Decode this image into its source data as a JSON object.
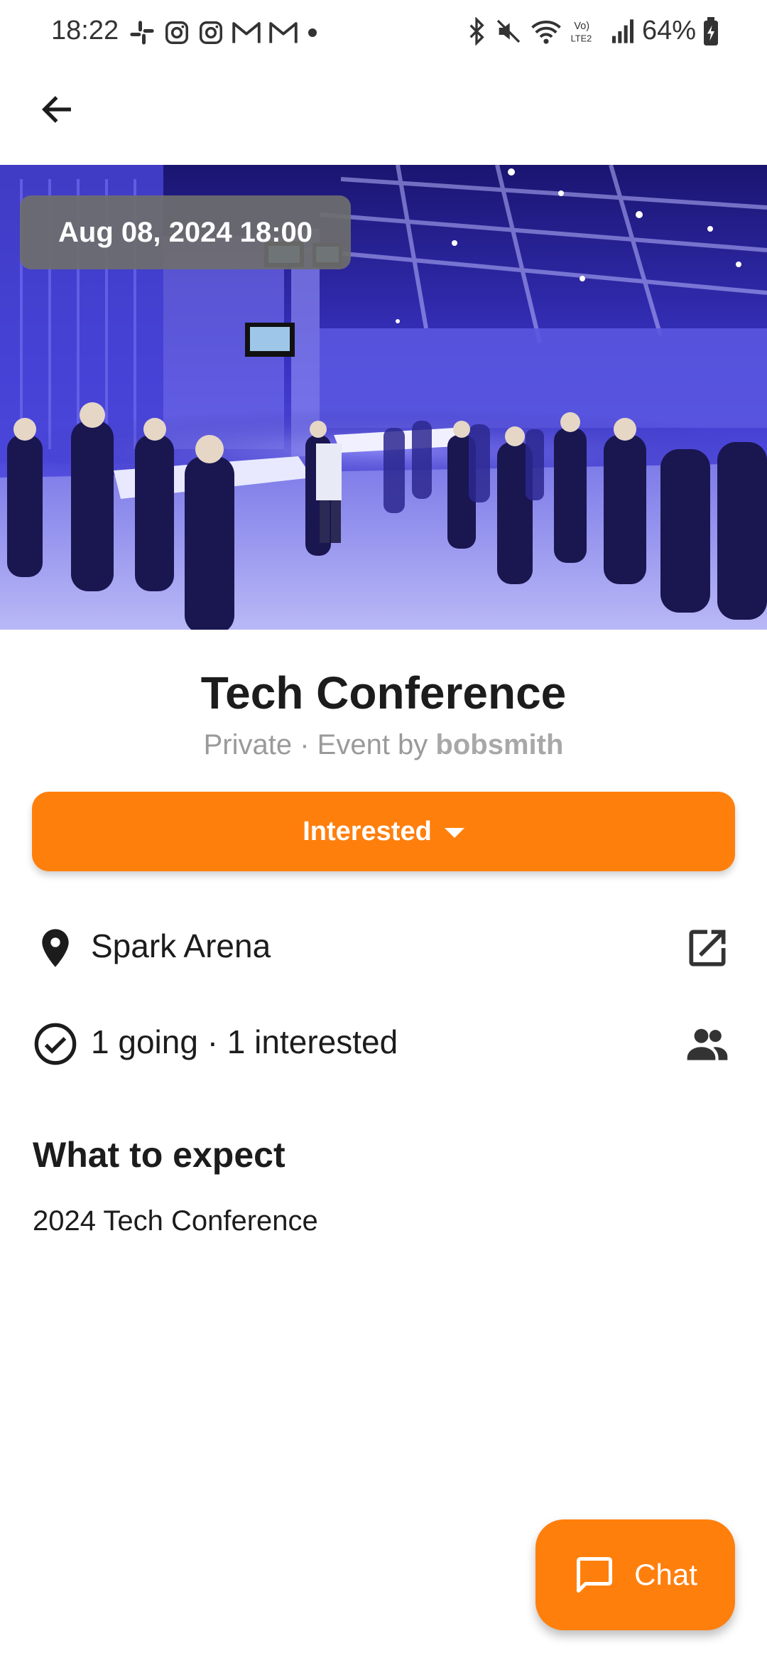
{
  "status_bar": {
    "time": "18:22",
    "battery": "64%",
    "left_icons": [
      "slack-icon",
      "instagram-icon",
      "instagram-icon",
      "gmail-icon",
      "gmail-icon",
      "dot-icon"
    ],
    "right_icons": [
      "bluetooth-icon",
      "mute-icon",
      "wifi-icon",
      "volte-icon",
      "signal-icon",
      "battery-icon"
    ]
  },
  "app_bar": {
    "back_icon": "arrow-back-icon"
  },
  "hero": {
    "date_time": "Aug 08, 2024 18:00"
  },
  "event": {
    "title": "Tech Conference",
    "visibility": "Private",
    "separator": " · ",
    "host_prefix": "Event by ",
    "host": "bobsmith"
  },
  "rsvp": {
    "label": "Interested"
  },
  "location": {
    "name": "Spark Arena"
  },
  "attendance": {
    "text": "1 going · 1 interested"
  },
  "description": {
    "heading": "What to expect",
    "body": "2024 Tech Conference"
  },
  "chat": {
    "label": "Chat"
  },
  "colors": {
    "accent": "#ff7f0d",
    "chip_bg": "#6e6e6e",
    "muted": "#9a9a9a"
  }
}
